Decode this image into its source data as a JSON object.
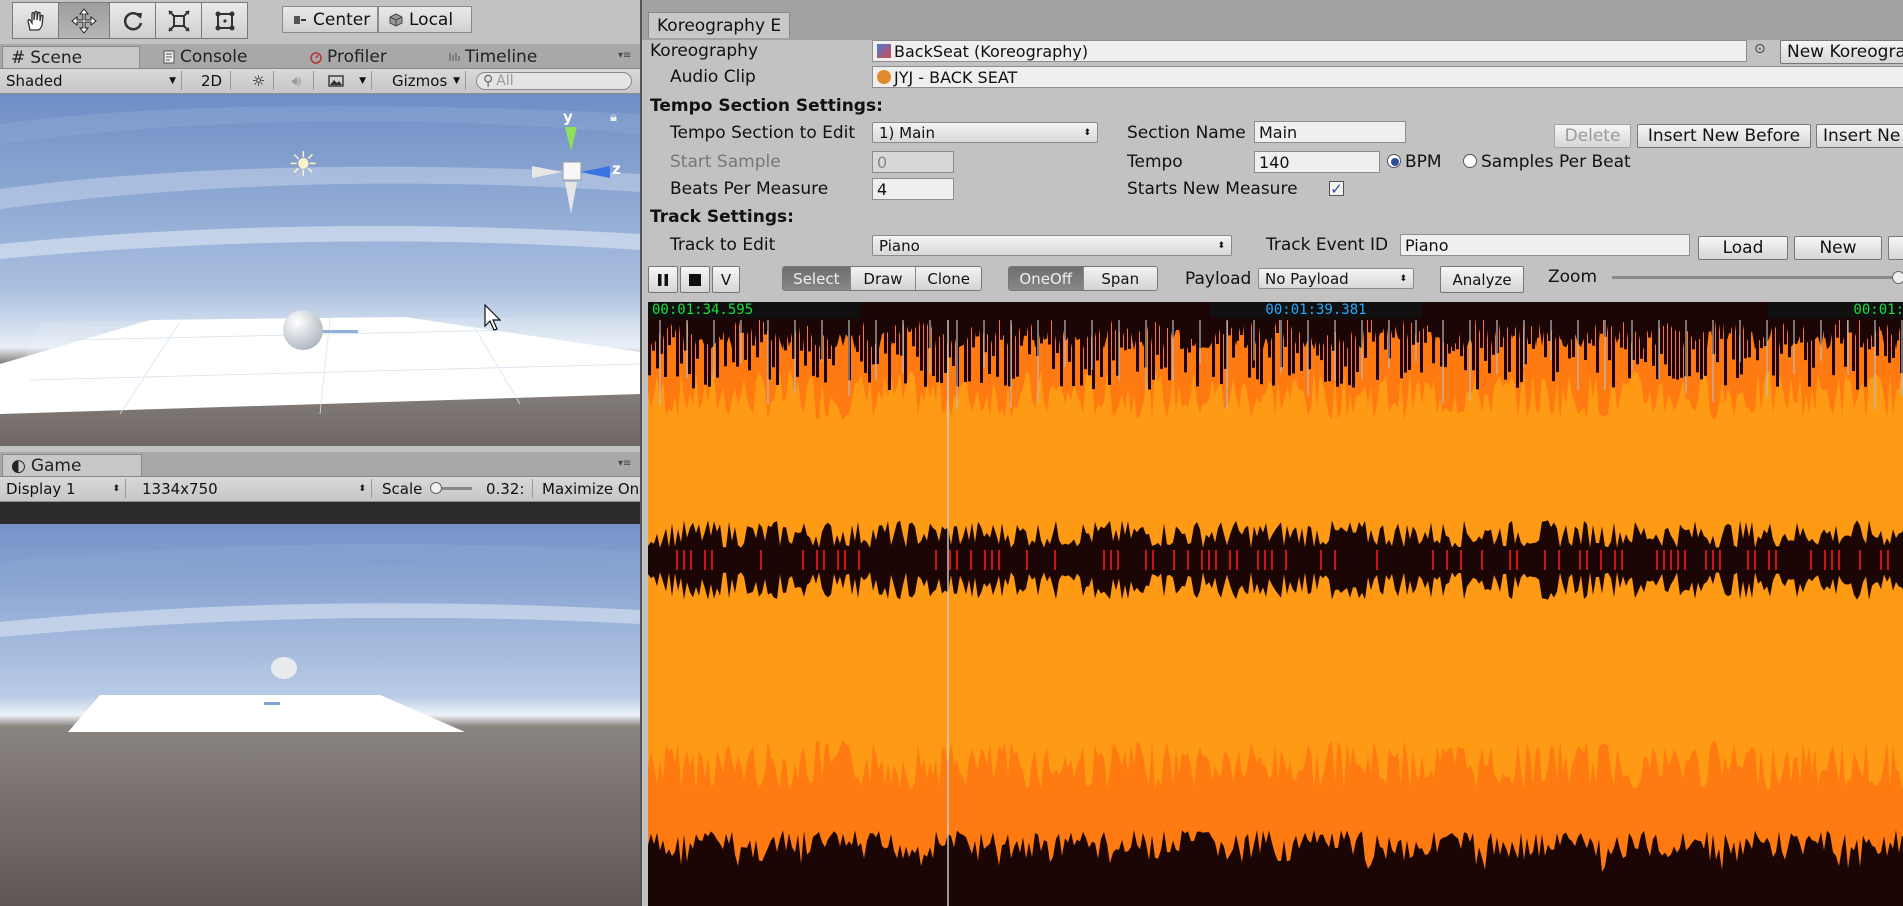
{
  "colors": {
    "waveform_dark": "#1c0605",
    "waveform_mid": "#ff7a10",
    "waveform_light": "#ff9a14",
    "waveform_accent": "#cc1414",
    "time_green": "#18e03c",
    "time_blue": "#2ca8ff",
    "sky_top": "#7696c8",
    "ground": "#5f5853"
  },
  "toolbar": {
    "tools": [
      "hand-icon",
      "move-icon",
      "rotate-icon",
      "scale-icon",
      "rect-icon"
    ],
    "center_label": "Center",
    "local_label": "Local"
  },
  "scene_tabs": {
    "scene": "Scene",
    "console": "Console",
    "profiler": "Profiler",
    "timeline": "Timeline"
  },
  "scene_bar": {
    "shading": "Shaded",
    "mode_2d": "2D",
    "gizmos": "Gizmos",
    "search_placeholder": "All"
  },
  "gizmo": {
    "y": "y",
    "z": "z"
  },
  "game_pane": {
    "tab": "Game",
    "display": "Display 1",
    "resolution": "1334x750",
    "scale_label": "Scale",
    "scale_value": "0.32:",
    "maximize": "Maximize On"
  },
  "koreo": {
    "window_tab": "Koreography E",
    "koreography_label": "Koreography",
    "koreography_value": "BackSeat (Koreography)",
    "new_koreography": "New Koreogra",
    "audio_clip_label": "Audio Clip",
    "audio_clip_value": "JYJ - BACK SEAT",
    "tempo_header": "Tempo Section Settings:",
    "tempo_section_label": "Tempo Section to Edit",
    "tempo_section_value": "1) Main",
    "section_name_label": "Section Name",
    "section_name_value": "Main",
    "delete": "Delete",
    "insert_before": "Insert New Before",
    "insert_after": "Insert Ne",
    "start_sample_label": "Start Sample",
    "start_sample_value": "0",
    "tempo_label": "Tempo",
    "tempo_value": "140",
    "bpm": "BPM",
    "samples_per_beat": "Samples Per Beat",
    "beats_label": "Beats Per Measure",
    "beats_value": "4",
    "starts_new_measure": "Starts New Measure",
    "check": "✓",
    "track_header": "Track Settings:",
    "track_label": "Track to Edit",
    "track_value": "Piano",
    "event_id_label": "Track Event ID",
    "event_id_value": "Piano",
    "load": "Load",
    "new": "New",
    "select": "Select",
    "draw": "Draw",
    "clone": "Clone",
    "oneoff": "OneOff",
    "span": "Span",
    "v": "V",
    "payload_label": "Payload",
    "payload_value": "No Payload",
    "analyze": "Analyze",
    "zoom_label": "Zoom"
  },
  "timeline": {
    "time_left": "00:01:34.595",
    "time_mid": "00:01:39.381",
    "time_right": "00:01:"
  }
}
